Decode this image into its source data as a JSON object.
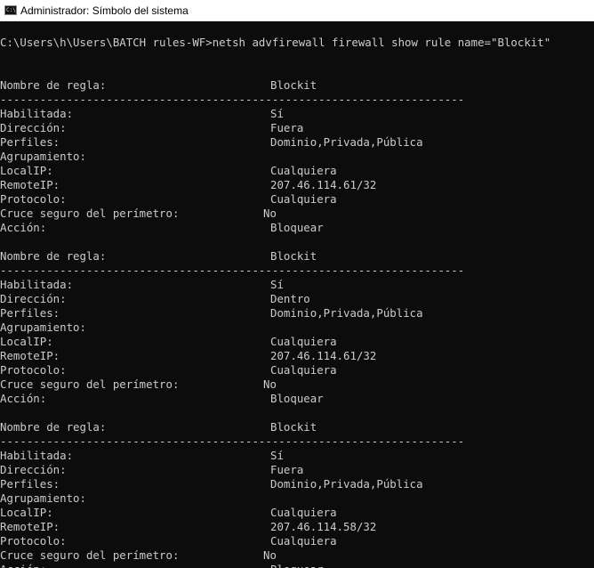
{
  "window": {
    "title": "Administrador: Símbolo del sistema",
    "icon_text": "C:\\"
  },
  "console": {
    "command": "C:\\Users\\h\\Users\\BATCH rules-WF>netsh advfirewall firewall show rule name=\"Blockit\"",
    "separator": "----------------------------------------------------------------------",
    "rules": [
      {
        "name_label": "Nombre de regla:",
        "name": "Blockit",
        "fields": [
          {
            "label": "Habilitada:",
            "value": "Sí"
          },
          {
            "label": "Dirección:",
            "value": "Fuera"
          },
          {
            "label": "Perfiles:",
            "value": "Dominio,Privada,Pública"
          },
          {
            "label": "Agrupamiento:",
            "value": ""
          },
          {
            "label": "LocalIP:",
            "value": "Cualquiera"
          },
          {
            "label": "RemoteIP:",
            "value": "207.46.114.61/32"
          },
          {
            "label": "Protocolo:",
            "value": "Cualquiera"
          },
          {
            "label": "Cruce seguro del perímetro:",
            "value": "No"
          },
          {
            "label": "Acción:",
            "value": "Bloquear"
          }
        ]
      },
      {
        "name_label": "Nombre de regla:",
        "name": "Blockit",
        "fields": [
          {
            "label": "Habilitada:",
            "value": "Sí"
          },
          {
            "label": "Dirección:",
            "value": "Dentro"
          },
          {
            "label": "Perfiles:",
            "value": "Dominio,Privada,Pública"
          },
          {
            "label": "Agrupamiento:",
            "value": ""
          },
          {
            "label": "LocalIP:",
            "value": "Cualquiera"
          },
          {
            "label": "RemoteIP:",
            "value": "207.46.114.61/32"
          },
          {
            "label": "Protocolo:",
            "value": "Cualquiera"
          },
          {
            "label": "Cruce seguro del perímetro:",
            "value": "No"
          },
          {
            "label": "Acción:",
            "value": "Bloquear"
          }
        ]
      },
      {
        "name_label": "Nombre de regla:",
        "name": "Blockit",
        "fields": [
          {
            "label": "Habilitada:",
            "value": "Sí"
          },
          {
            "label": "Dirección:",
            "value": "Fuera"
          },
          {
            "label": "Perfiles:",
            "value": "Dominio,Privada,Pública"
          },
          {
            "label": "Agrupamiento:",
            "value": ""
          },
          {
            "label": "LocalIP:",
            "value": "Cualquiera"
          },
          {
            "label": "RemoteIP:",
            "value": "207.46.114.58/32"
          },
          {
            "label": "Protocolo:",
            "value": "Cualquiera"
          },
          {
            "label": "Cruce seguro del perímetro:",
            "value": "No"
          },
          {
            "label": "Acción:",
            "value": "Bloquear"
          }
        ]
      }
    ]
  },
  "colors": {
    "console_bg": "#0c0c0c",
    "console_text": "#cccccc",
    "titlebar_bg": "#ffffff"
  }
}
